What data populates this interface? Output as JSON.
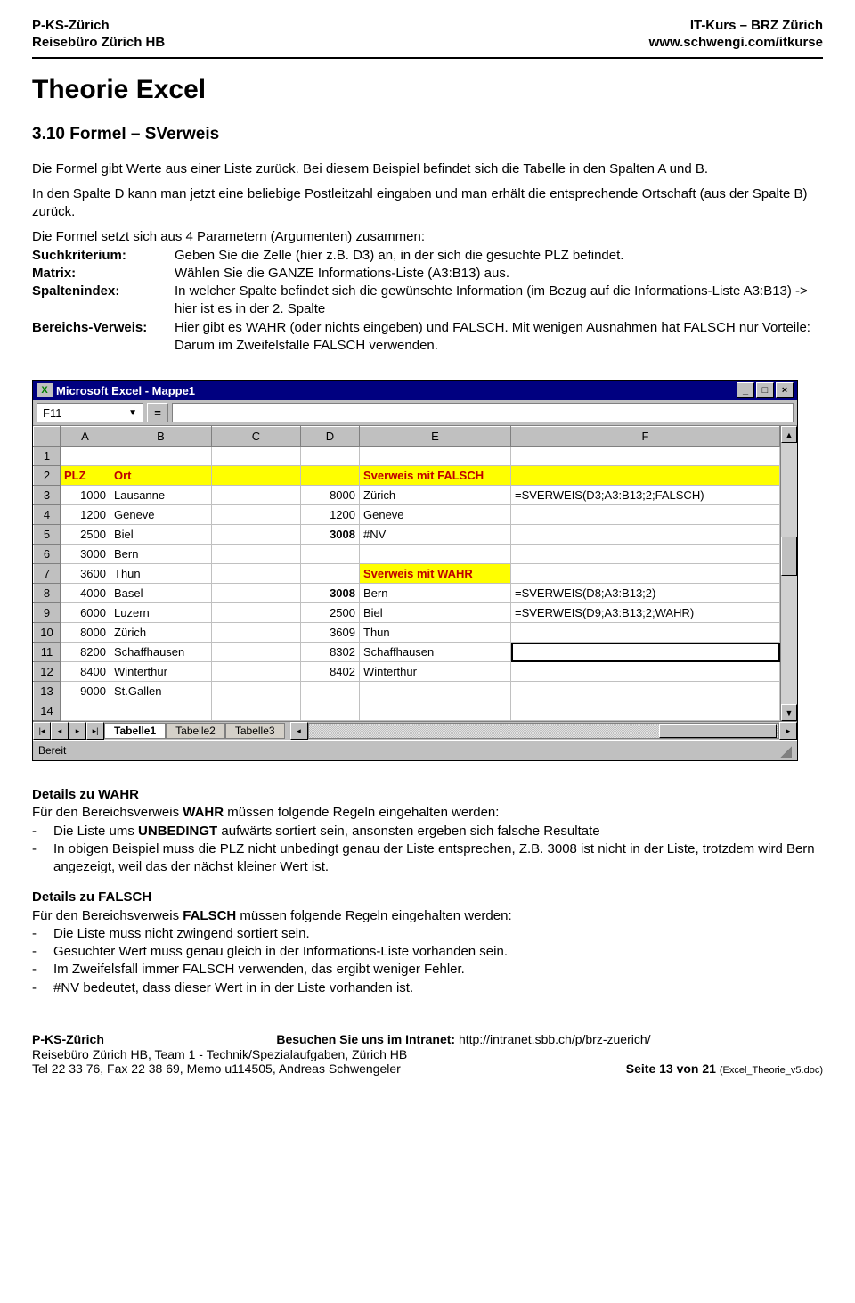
{
  "header": {
    "left": "P-KS-Zürich\nReisebüro Zürich HB",
    "right": "IT-Kurs – BRZ Zürich\nwww.schwengi.com/itkurse"
  },
  "title": "Theorie Excel",
  "section": "3.10  Formel – SVerweis",
  "intro": [
    "Die Formel gibt Werte aus einer Liste zurück. Bei diesem Beispiel befindet sich die Tabelle in den Spalten A und B.",
    "In den Spalte D kann man jetzt eine beliebige Postleitzahl eingaben und man erhält die entsprechende Ortschaft (aus der Spalte B) zurück.",
    "Die Formel setzt sich aus 4 Parametern (Argumenten) zusammen:"
  ],
  "defs": [
    {
      "term": "Suchkriterium:",
      "def": "Geben Sie die Zelle (hier z.B. D3) an, in der sich die gesuchte PLZ befindet."
    },
    {
      "term": "Matrix:",
      "def": "Wählen Sie die GANZE Informations-Liste (A3:B13) aus."
    },
    {
      "term": "Spaltenindex:",
      "def": "In welcher Spalte befindet sich die gewünschte Information (im Bezug auf die Informations-Liste A3:B13) -> hier ist es in der 2. Spalte"
    },
    {
      "term": "Bereichs-Verweis:",
      "def": "Hier gibt es WAHR (oder nichts eingeben) und FALSCH. Mit wenigen Ausnahmen hat FALSCH nur Vorteile: Darum im Zweifelsfalle FALSCH verwenden."
    }
  ],
  "excel": {
    "title": "Microsoft Excel - Mappe1",
    "namebox": "F11",
    "cols": [
      "A",
      "B",
      "C",
      "D",
      "E",
      "F"
    ],
    "tabs": [
      "Tabelle1",
      "Tabelle2",
      "Tabelle3"
    ],
    "active_tab": 0,
    "status": "Bereit",
    "rows": [
      {
        "n": "1",
        "a": "",
        "b": "",
        "d": "",
        "e": "",
        "f": ""
      },
      {
        "n": "2",
        "a": "PLZ",
        "b": "Ort",
        "d": "",
        "e": "Sverweis mit FALSCH",
        "f": "",
        "hlRow": true,
        "redA": true,
        "redB": true,
        "redE": true
      },
      {
        "n": "3",
        "a": "1000",
        "b": "Lausanne",
        "d": "8000",
        "e": "Zürich",
        "f": "=SVERWEIS(D3;A3:B13;2;FALSCH)"
      },
      {
        "n": "4",
        "a": "1200",
        "b": "Geneve",
        "d": "1200",
        "e": "Geneve",
        "f": ""
      },
      {
        "n": "5",
        "a": "2500",
        "b": "Biel",
        "d": "3008",
        "e": "#NV",
        "f": "",
        "boldD": true
      },
      {
        "n": "6",
        "a": "3000",
        "b": "Bern",
        "d": "",
        "e": "",
        "f": ""
      },
      {
        "n": "7",
        "a": "3600",
        "b": "Thun",
        "d": "",
        "e": "Sverweis mit WAHR",
        "f": "",
        "hlE": true,
        "redE": true
      },
      {
        "n": "8",
        "a": "4000",
        "b": "Basel",
        "d": "3008",
        "e": "Bern",
        "f": "=SVERWEIS(D8;A3:B13;2)",
        "boldD": true
      },
      {
        "n": "9",
        "a": "6000",
        "b": "Luzern",
        "d": "2500",
        "e": "Biel",
        "f": "=SVERWEIS(D9;A3:B13;2;WAHR)"
      },
      {
        "n": "10",
        "a": "8000",
        "b": "Zürich",
        "d": "3609",
        "e": "Thun",
        "f": ""
      },
      {
        "n": "11",
        "a": "8200",
        "b": "Schaffhausen",
        "d": "8302",
        "e": "Schaffhausen",
        "f": "",
        "selF": true
      },
      {
        "n": "12",
        "a": "8400",
        "b": "Winterthur",
        "d": "8402",
        "e": "Winterthur",
        "f": ""
      },
      {
        "n": "13",
        "a": "9000",
        "b": "St.Gallen",
        "d": "",
        "e": "",
        "f": ""
      },
      {
        "n": "14",
        "a": "",
        "b": "",
        "d": "",
        "e": "",
        "f": ""
      }
    ]
  },
  "chart_data": {
    "type": "table",
    "title": "SVERWEIS Beispiel",
    "columns": [
      "PLZ",
      "Ort"
    ],
    "rows": [
      [
        1000,
        "Lausanne"
      ],
      [
        1200,
        "Geneve"
      ],
      [
        2500,
        "Biel"
      ],
      [
        3000,
        "Bern"
      ],
      [
        3600,
        "Thun"
      ],
      [
        4000,
        "Basel"
      ],
      [
        6000,
        "Luzern"
      ],
      [
        8000,
        "Zürich"
      ],
      [
        8200,
        "Schaffhausen"
      ],
      [
        8400,
        "Winterthur"
      ],
      [
        9000,
        "St.Gallen"
      ]
    ],
    "lookups_FALSCH": [
      {
        "d": 8000,
        "result": "Zürich",
        "formula": "=SVERWEIS(D3;A3:B13;2;FALSCH)"
      },
      {
        "d": 1200,
        "result": "Geneve"
      },
      {
        "d": 3008,
        "result": "#NV"
      }
    ],
    "lookups_WAHR": [
      {
        "d": 3008,
        "result": "Bern",
        "formula": "=SVERWEIS(D8;A3:B13;2)"
      },
      {
        "d": 2500,
        "result": "Biel",
        "formula": "=SVERWEIS(D9;A3:B13;2;WAHR)"
      },
      {
        "d": 3609,
        "result": "Thun"
      },
      {
        "d": 8302,
        "result": "Schaffhausen"
      },
      {
        "d": 8402,
        "result": "Winterthur"
      }
    ]
  },
  "wahr": {
    "title": "Details zu WAHR",
    "intro_a": "Für den Bereichsverweis ",
    "intro_b": "WAHR",
    "intro_c": " müssen folgende Regeln eingehalten werden:",
    "items": [
      {
        "a": "Die Liste ums ",
        "b": "UNBEDINGT",
        "c": " aufwärts sortiert sein, ansonsten ergeben sich falsche Resultate"
      },
      {
        "a": "In obigen Beispiel muss die PLZ nicht unbedingt genau der Liste entsprechen, Z.B. 3008 ist nicht in der Liste, trotzdem wird Bern angezeigt, weil das der nächst kleiner Wert ist.",
        "b": "",
        "c": ""
      }
    ]
  },
  "falsch": {
    "title": "Details zu FALSCH",
    "intro_a": "Für den Bereichsverweis ",
    "intro_b": "FALSCH",
    "intro_c": " müssen folgende Regeln eingehalten werden:",
    "items": [
      "Die Liste muss nicht zwingend sortiert sein.",
      "Gesuchter Wert muss genau gleich in der Informations-Liste vorhanden sein.",
      "Im Zweifelsfall immer FALSCH verwenden, das ergibt weniger Fehler.",
      "#NV bedeutet, dass dieser Wert in in der Liste vorhanden ist."
    ]
  },
  "footer": {
    "left1": "P-KS-Zürich",
    "center": "Besuchen Sie uns im Intranet: ",
    "center_url": "http://intranet.sbb.ch/p/brz-zuerich/",
    "left2": "Reisebüro Zürich HB, Team 1 - Technik/Spezialaufgaben, Zürich HB",
    "left3": "Tel  22 33 76, Fax  22 38 69, Memo  u114505, Andreas Schwengeler",
    "right": "Seite 13 von 21 ",
    "right_small": "(Excel_Theorie_v5.doc)"
  }
}
